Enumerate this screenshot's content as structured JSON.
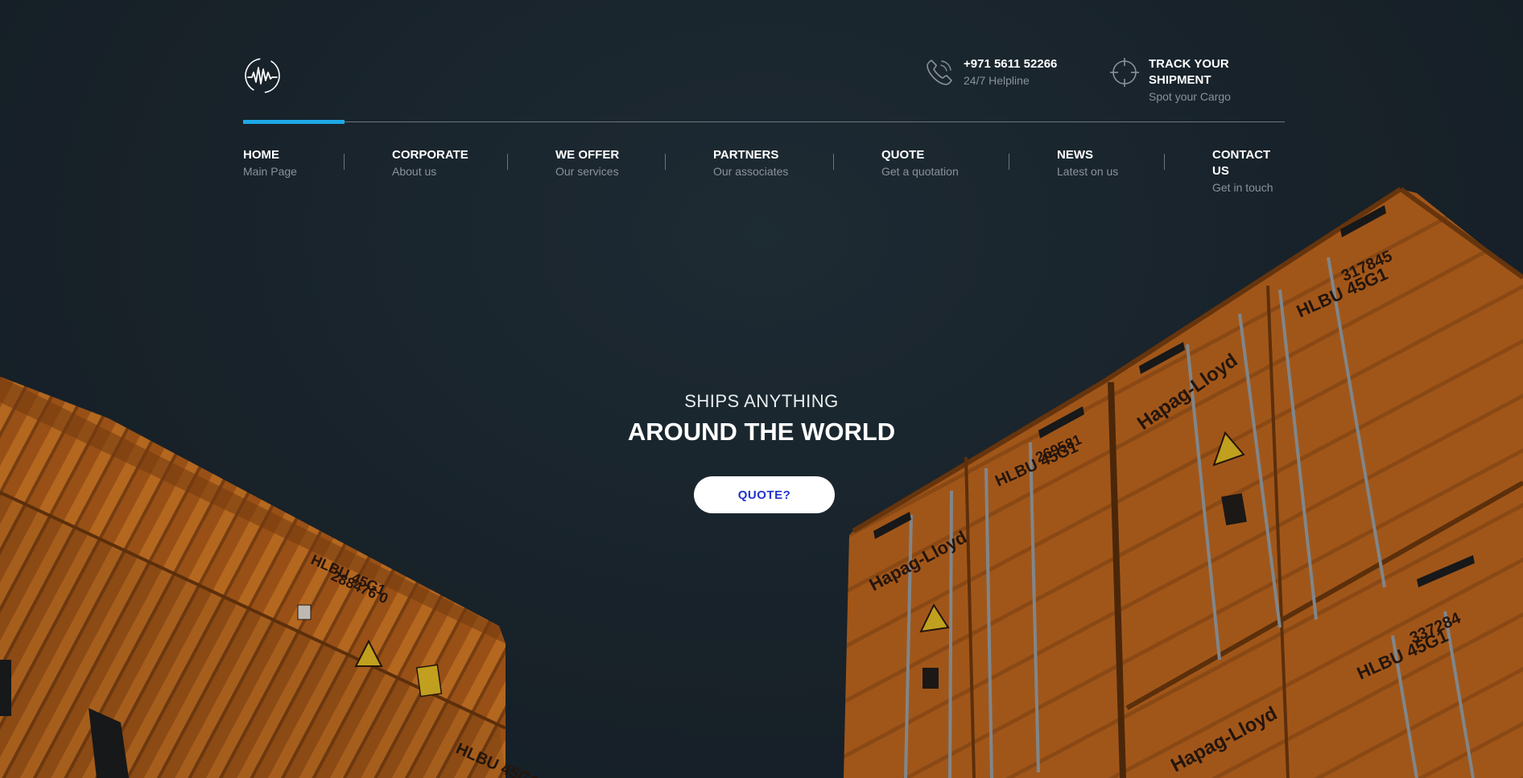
{
  "contact": {
    "phone": "+971 5611 52266",
    "phone_sub": "24/7 Helpline",
    "track": "TRACK YOUR SHIPMENT",
    "track_sub": "Spot your Cargo"
  },
  "nav": [
    {
      "title": "HOME",
      "sub": "Main Page"
    },
    {
      "title": "CORPORATE",
      "sub": "About us"
    },
    {
      "title": "WE OFFER",
      "sub": "Our services"
    },
    {
      "title": "PARTNERS",
      "sub": "Our associates"
    },
    {
      "title": "QUOTE",
      "sub": "Get a quotation"
    },
    {
      "title": "NEWS",
      "sub": "Latest on us"
    },
    {
      "title": "CONTACT US",
      "sub": "Get in touch"
    }
  ],
  "nav_active_index": 0,
  "hero": {
    "kicker": "SHIPS ANYTHING",
    "title": "AROUND THE WORLD",
    "button": "QUOTE?"
  },
  "containers": {
    "left_code": "HLBU 45G1",
    "left_number": "288476 0",
    "right_brand": "Hapag-Lloyd",
    "right_code": "HLBU 45G1",
    "right_number_top": "317845",
    "right_number_mid": "269581",
    "right_number_bottom": "337284"
  },
  "colors": {
    "accent": "#1fa8e6",
    "container": "#c8691a",
    "button_text": "#2233cc"
  }
}
